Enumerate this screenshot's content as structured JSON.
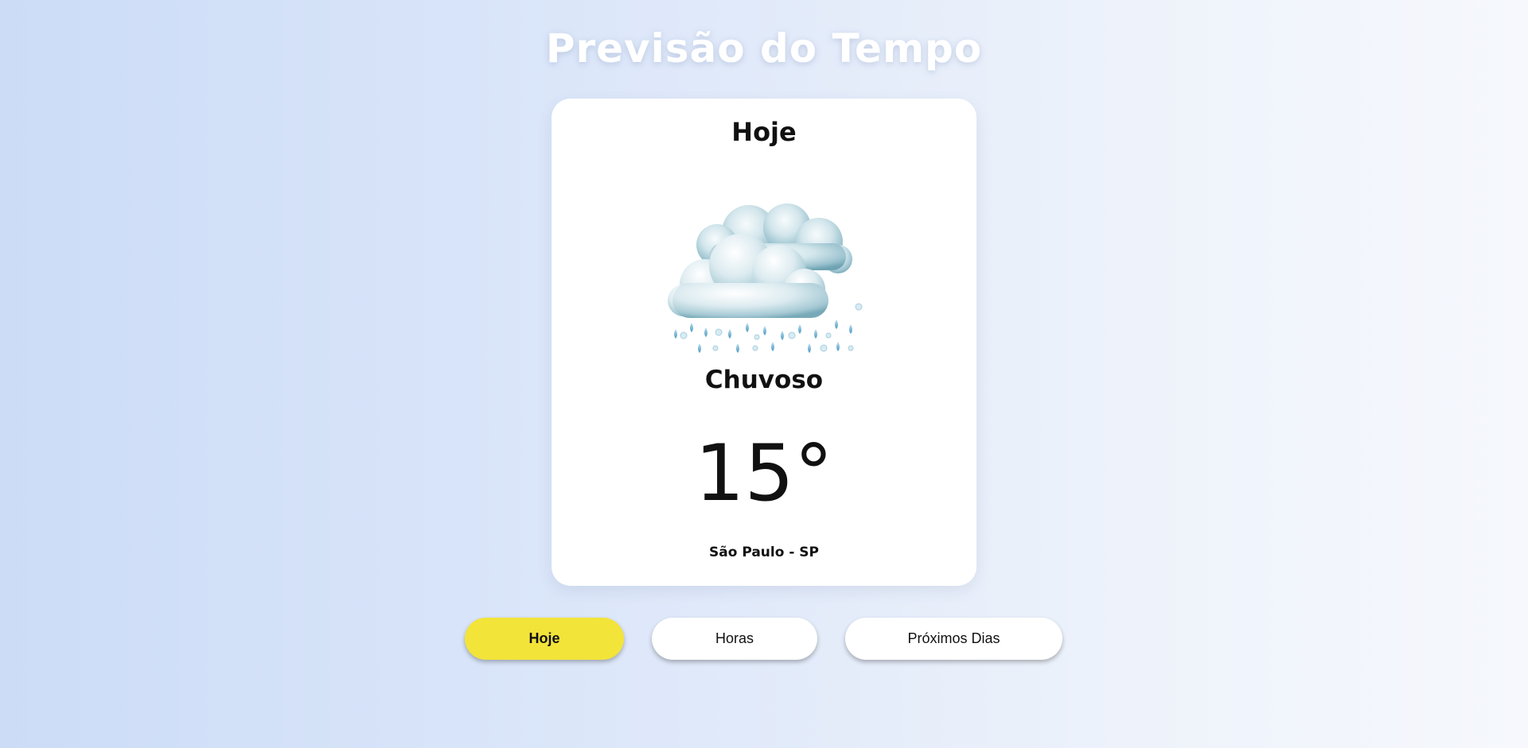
{
  "header": {
    "title": "Previsão do Tempo"
  },
  "card": {
    "title": "Hoje",
    "condition": "Chuvoso",
    "temperature": "15°",
    "location": "São Paulo - SP",
    "icon": "rain-cloud-icon"
  },
  "tabs": [
    {
      "label": "Hoje",
      "active": true
    },
    {
      "label": "Horas",
      "active": false
    },
    {
      "label": "Próximos Dias",
      "active": false
    }
  ],
  "colors": {
    "active_tab": "#f3e43a",
    "card_background": "#ffffff",
    "title_text": "#ffffff"
  }
}
